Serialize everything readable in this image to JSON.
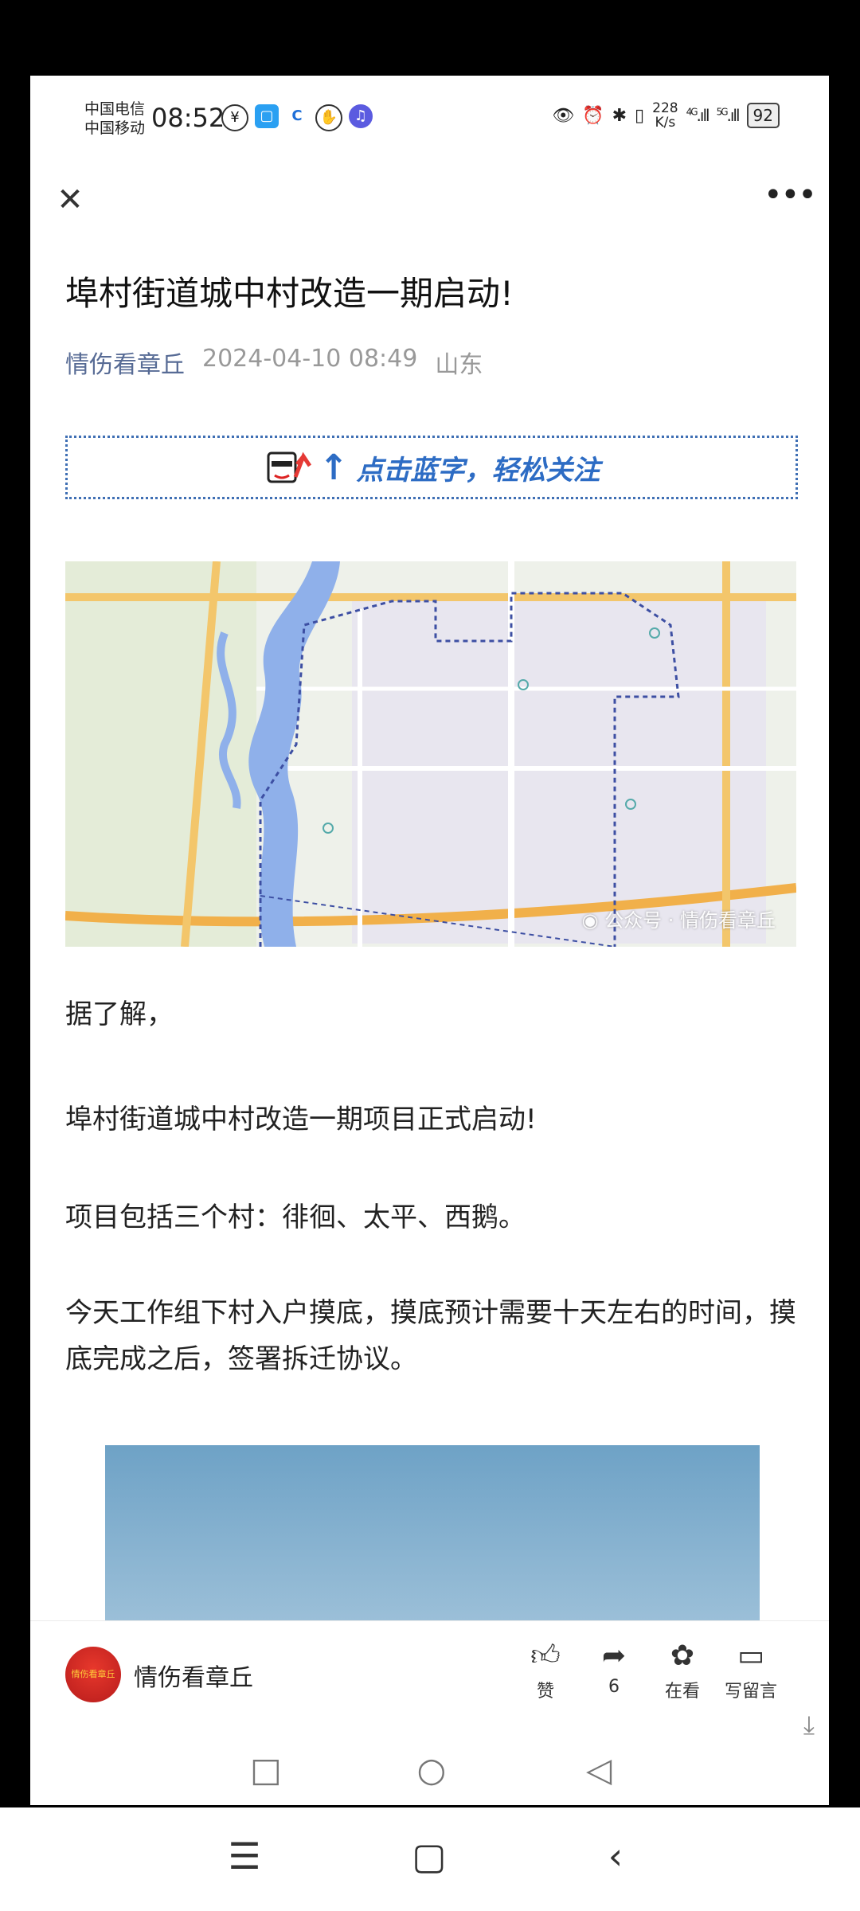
{
  "status_bar": {
    "carrier1": "中国电信",
    "carrier2": "中国移动",
    "time": "08:52",
    "speed_value": "228",
    "speed_unit": "K/s",
    "net1": "4G",
    "net2": "5G",
    "battery": "92"
  },
  "top_bar": {
    "close_icon": "close-icon",
    "more_icon": "more-icon"
  },
  "article": {
    "title": "埠村街道城中村改造一期启动!",
    "author": "情伤看章丘",
    "datetime": "2024-04-10 08:49",
    "location": "山东",
    "follow_banner": "点击蓝字，轻松关注",
    "map_watermark": "公众号 · 情伤看章丘",
    "paragraphs": [
      "据了解，",
      "埠村街道城中村改造一期项目正式启动!",
      "项目包括三个村：徘徊、太平、西鹅。",
      "今天工作组下村入户摸底，摸底预计需要十天左右的时间，摸底完成之后，签署拆迁协议。"
    ]
  },
  "bottom_bar": {
    "account_name": "情伤看章丘",
    "avatar_text": "情伤看章丘",
    "actions": [
      {
        "label": "赞",
        "icon": "thumbs-up-icon"
      },
      {
        "label": "6",
        "icon": "share-icon"
      },
      {
        "label": "在看",
        "icon": "wow-icon"
      },
      {
        "label": "写留言",
        "icon": "comment-icon"
      }
    ]
  },
  "colors": {
    "link": "#576b95",
    "accent": "#2d6cc4",
    "water": "#8fb0ea"
  }
}
